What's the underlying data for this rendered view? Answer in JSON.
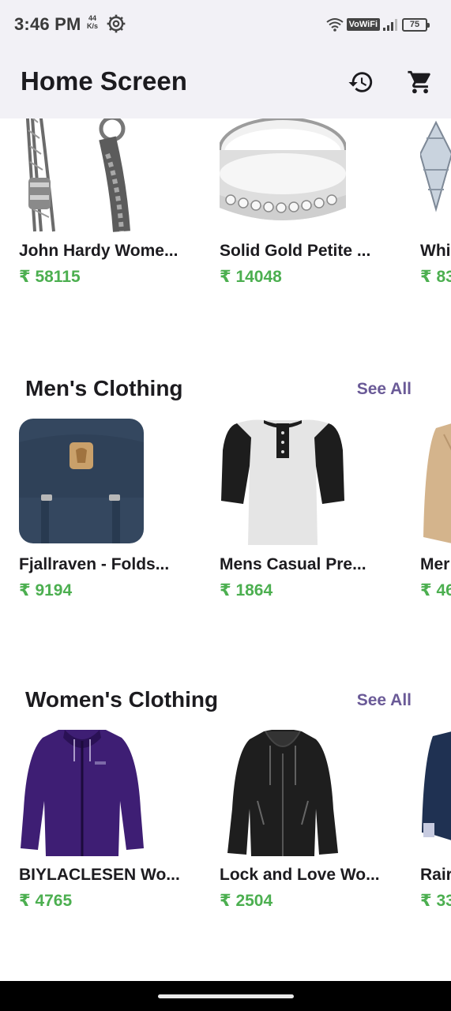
{
  "status_bar": {
    "time": "3:46 PM",
    "speed_value": "44",
    "speed_unit": "K/s",
    "network_label": "VoWiFi",
    "battery": "75"
  },
  "app_bar": {
    "title": "Home Screen",
    "history_icon": "history-icon",
    "cart_icon": "cart-icon"
  },
  "rows": [
    {
      "section_title": "",
      "items": [
        {
          "name": "John Hardy Wome...",
          "price": "₹ 58115"
        },
        {
          "name": "Solid Gold Petite ...",
          "price": "₹ 14048"
        },
        {
          "name": "Whi",
          "price": "₹ 83"
        }
      ]
    },
    {
      "section_title": "Men's Clothing",
      "see_all": "See All",
      "items": [
        {
          "name": "Fjallraven - Folds...",
          "price": "₹ 9194"
        },
        {
          "name": "Mens Casual Pre...",
          "price": "₹ 1864"
        },
        {
          "name": "Mer",
          "price": "₹ 46"
        }
      ]
    },
    {
      "section_title": "Women's Clothing",
      "see_all": "See All",
      "items": [
        {
          "name": "BIYLACLESEN Wo...",
          "price": "₹ 4765"
        },
        {
          "name": "Lock and Love Wo...",
          "price": "₹ 2504"
        },
        {
          "name": "Rair",
          "price": "₹ 33"
        }
      ]
    }
  ],
  "colors": {
    "price": "#4caf50",
    "see_all": "#6a5a97",
    "app_bar_bg": "#f2f1f6"
  }
}
